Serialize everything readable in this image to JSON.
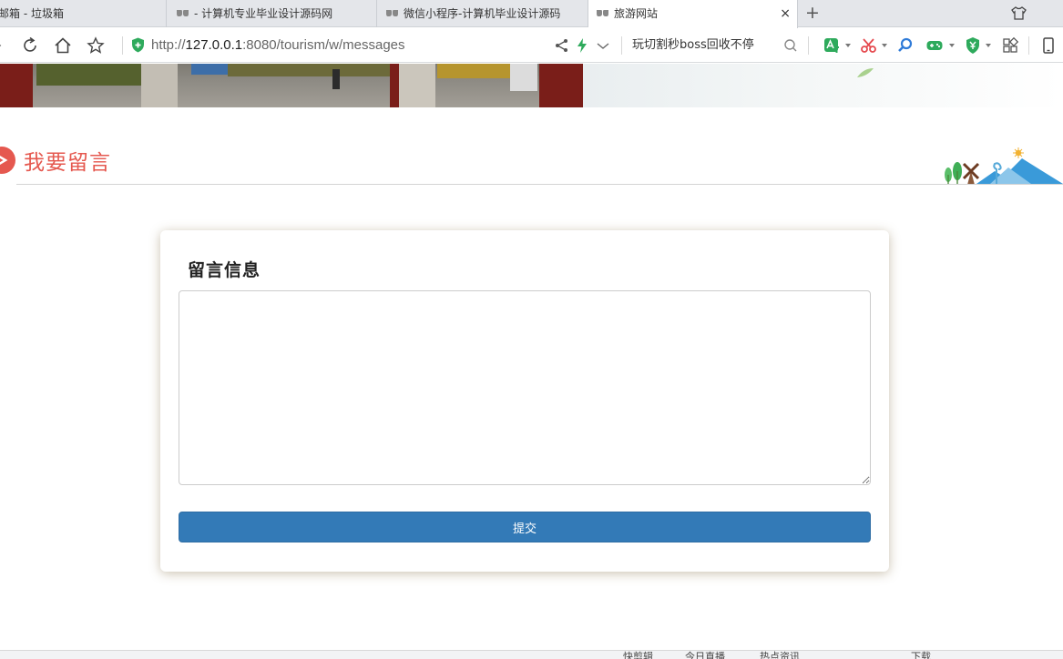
{
  "browser": {
    "tabs": [
      {
        "title": "邮箱 - 垃圾箱",
        "active": false
      },
      {
        "title": "- 计算机专业毕业设计源码网",
        "active": false
      },
      {
        "title": "微信小程序-计算机毕业设计源码",
        "active": false
      },
      {
        "title": "旅游网站",
        "active": true
      }
    ],
    "tab_close": "×",
    "new_tab": "+",
    "url": {
      "scheme": "http://",
      "host": "127.0.0.1",
      "rest": ":8080/tourism/w/messages"
    },
    "search_suggestion": "玩切割秒boss回收不停",
    "accent_color": "#2eaa5c"
  },
  "page": {
    "section_title": "我要留言",
    "section_title_color": "#e5584f",
    "form": {
      "title": "留言信息",
      "message_value": "",
      "message_placeholder": "",
      "submit_label": "提交",
      "submit_color": "#337ab7"
    }
  },
  "statusbar": {
    "items": [
      "快剪辑",
      "今日直播",
      "热点资讯",
      "下载"
    ]
  }
}
